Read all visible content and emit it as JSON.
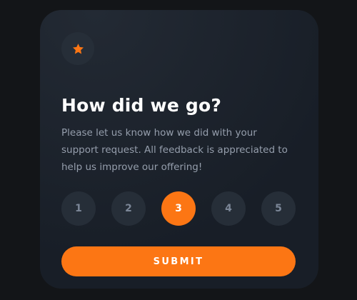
{
  "card": {
    "badge_icon": "star-icon",
    "title": "How did we go?",
    "description": "Please let us know how we did with your support request. All feedback is appreciated to help us improve our offering!"
  },
  "ratings": {
    "options": [
      "1",
      "2",
      "3",
      "4",
      "5"
    ],
    "selected": "3"
  },
  "submit": {
    "label": "SUBMIT"
  },
  "colors": {
    "accent": "#FC7614",
    "page_background": "#131518",
    "card_background": "#1E252E",
    "rating_background": "#262E38",
    "rating_text": "#7C8798",
    "muted_text": "#959EAC",
    "title_text": "#FFFFFF"
  }
}
